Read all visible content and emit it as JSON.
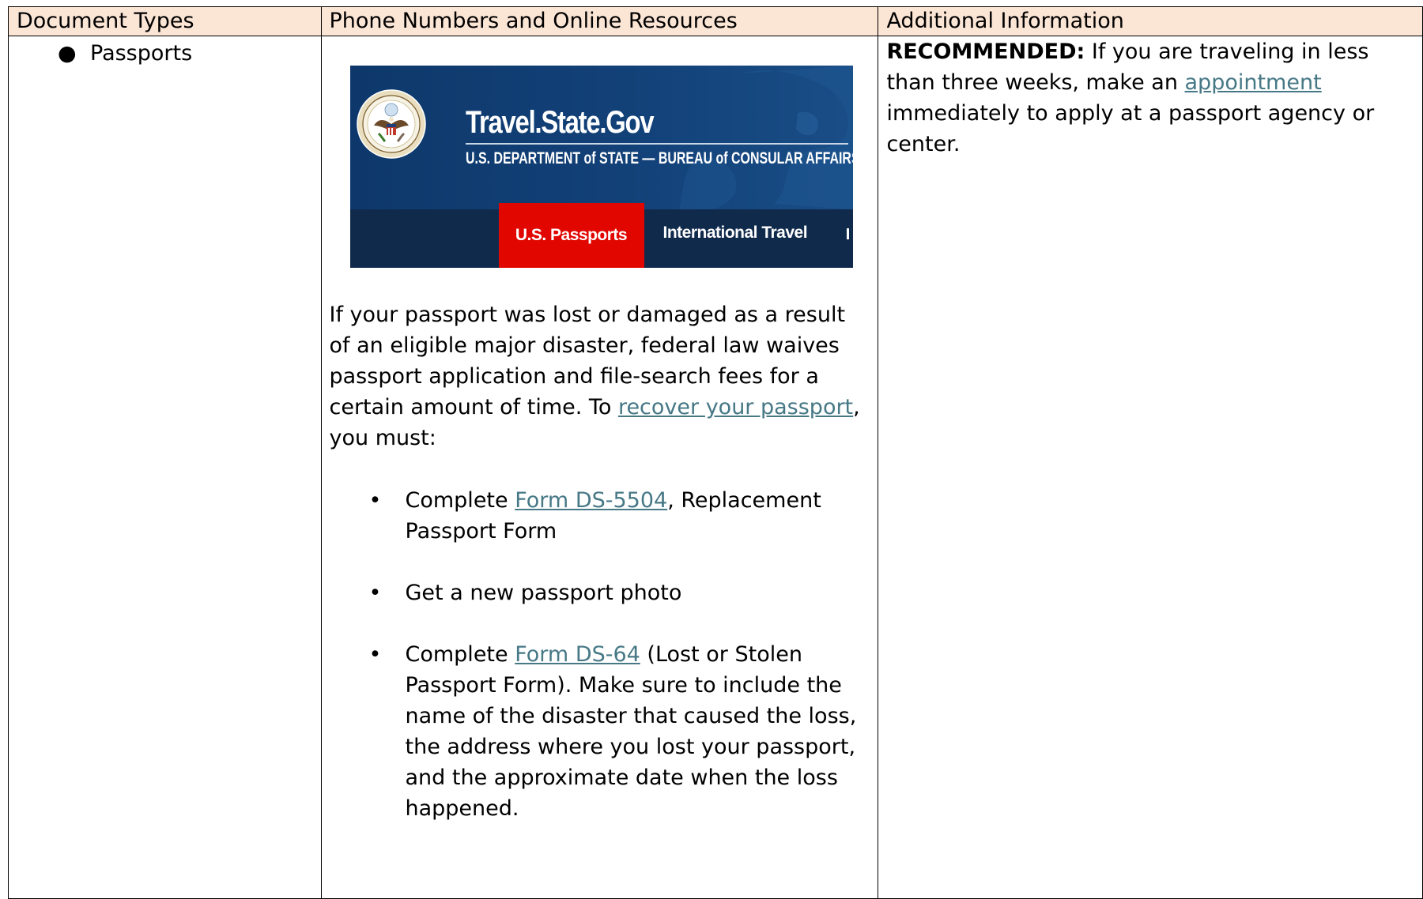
{
  "table": {
    "headers": [
      "Document Types",
      "Phone Numbers and Online Resources",
      "Additional Information"
    ]
  },
  "col1": {
    "bullet": "Passports"
  },
  "banner": {
    "title": "Travel.State.Gov",
    "subtitle": "U.S. DEPARTMENT of STATE — BUREAU of CONSULAR AFFAIRS",
    "nav_active": "U.S. Passports",
    "nav_item": "International Travel",
    "seal_icon": "state-department-seal-icon",
    "colors": {
      "banner_blue": "#0e386b",
      "nav_dark": "#102a4c",
      "nav_active_red": "#e10600"
    }
  },
  "col2": {
    "para_before_link": "If your passport was lost or damaged as a result of an eligible major disaster, federal law waives passport application and file-search fees for a certain amount of time. To ",
    "para_link": "recover your passport",
    "para_after_link": ", you must:",
    "steps": [
      {
        "before": "Complete ",
        "link": "Form DS-5504",
        "after": ", Replacement Passport Form"
      },
      {
        "before": "Get a new passport photo",
        "link": "",
        "after": ""
      },
      {
        "before": "Complete ",
        "link": "Form DS-64",
        "after": " (Lost or Stolen Passport Form). Make sure to include the name of the disaster that caused the loss, the address where you lost your passport, and the approximate date when the loss happened."
      }
    ]
  },
  "col3": {
    "label": "RECOMMENDED:",
    "before_link": " If you are traveling in less than three weeks, make an ",
    "link": "appointment",
    "after_link": " immediately to apply at a passport agency or center."
  },
  "colors": {
    "header_bg": "#fbe5d5",
    "link": "#467886",
    "border": "#000000"
  }
}
